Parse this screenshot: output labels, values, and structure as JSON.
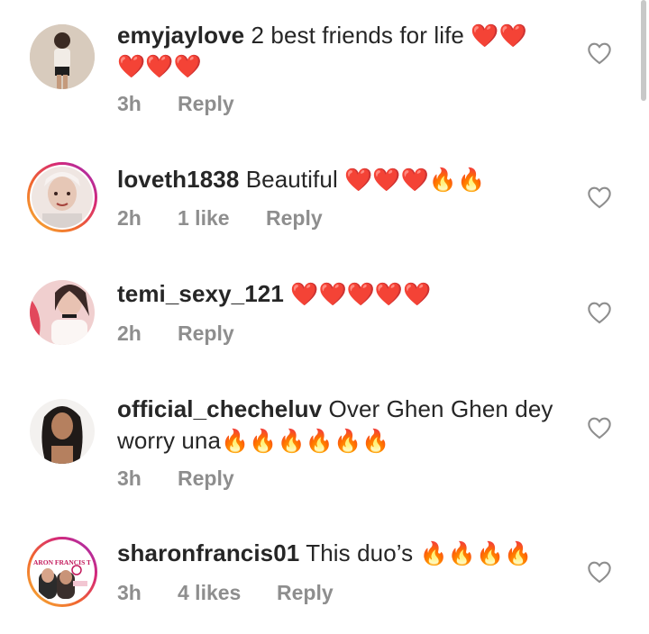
{
  "comments": [
    {
      "username": "emyjaylove",
      "text": "2 best friends for life",
      "emoji_line1": "❤️❤️",
      "emoji_line2": "❤️❤️❤️",
      "time": "3h",
      "likes": "",
      "reply": "Reply",
      "story_ring": false,
      "avatar_colors": [
        "#c9b8a8",
        "#2a2a2a",
        "#e8ddd0"
      ]
    },
    {
      "username": "loveth1838",
      "text": "Beautiful",
      "emoji_line1": "❤️❤️❤️🔥🔥",
      "time": "2h",
      "likes": "1 like",
      "reply": "Reply",
      "story_ring": true,
      "avatar_colors": [
        "#e9d6cf",
        "#7a4a3a",
        "#f4ece8"
      ]
    },
    {
      "username": "temi_sexy_121",
      "text": "",
      "emoji_line1": "❤️❤️❤️❤️❤️",
      "time": "2h",
      "likes": "",
      "reply": "Reply",
      "story_ring": false,
      "avatar_colors": [
        "#e25569",
        "#f3d3cf",
        "#3b2a2a"
      ]
    },
    {
      "username": "official_checheluv",
      "text": "Over Ghen Ghen dey",
      "text_line2": "worry una",
      "emoji_line2": "🔥🔥🔥🔥🔥🔥",
      "time": "3h",
      "likes": "",
      "reply": "Reply",
      "story_ring": false,
      "avatar_colors": [
        "#f1efed",
        "#1f1a18",
        "#b07a5e"
      ]
    },
    {
      "username": "sharonfrancis01",
      "text": "This duo’s",
      "emoji_line1": "🔥🔥🔥🔥",
      "time": "3h",
      "likes": "4 likes",
      "reply": "Reply",
      "story_ring": true,
      "avatar_text": "ARON FRANCIS T",
      "avatar_colors": [
        "#ffffff",
        "#c2185b",
        "#2b2b2b"
      ]
    }
  ],
  "colors": {
    "username": "#262626",
    "meta": "#8e8e8e",
    "heart": "#e4102c",
    "fire": "#f26a18"
  },
  "icons": {
    "like": "heart-outline-icon"
  }
}
